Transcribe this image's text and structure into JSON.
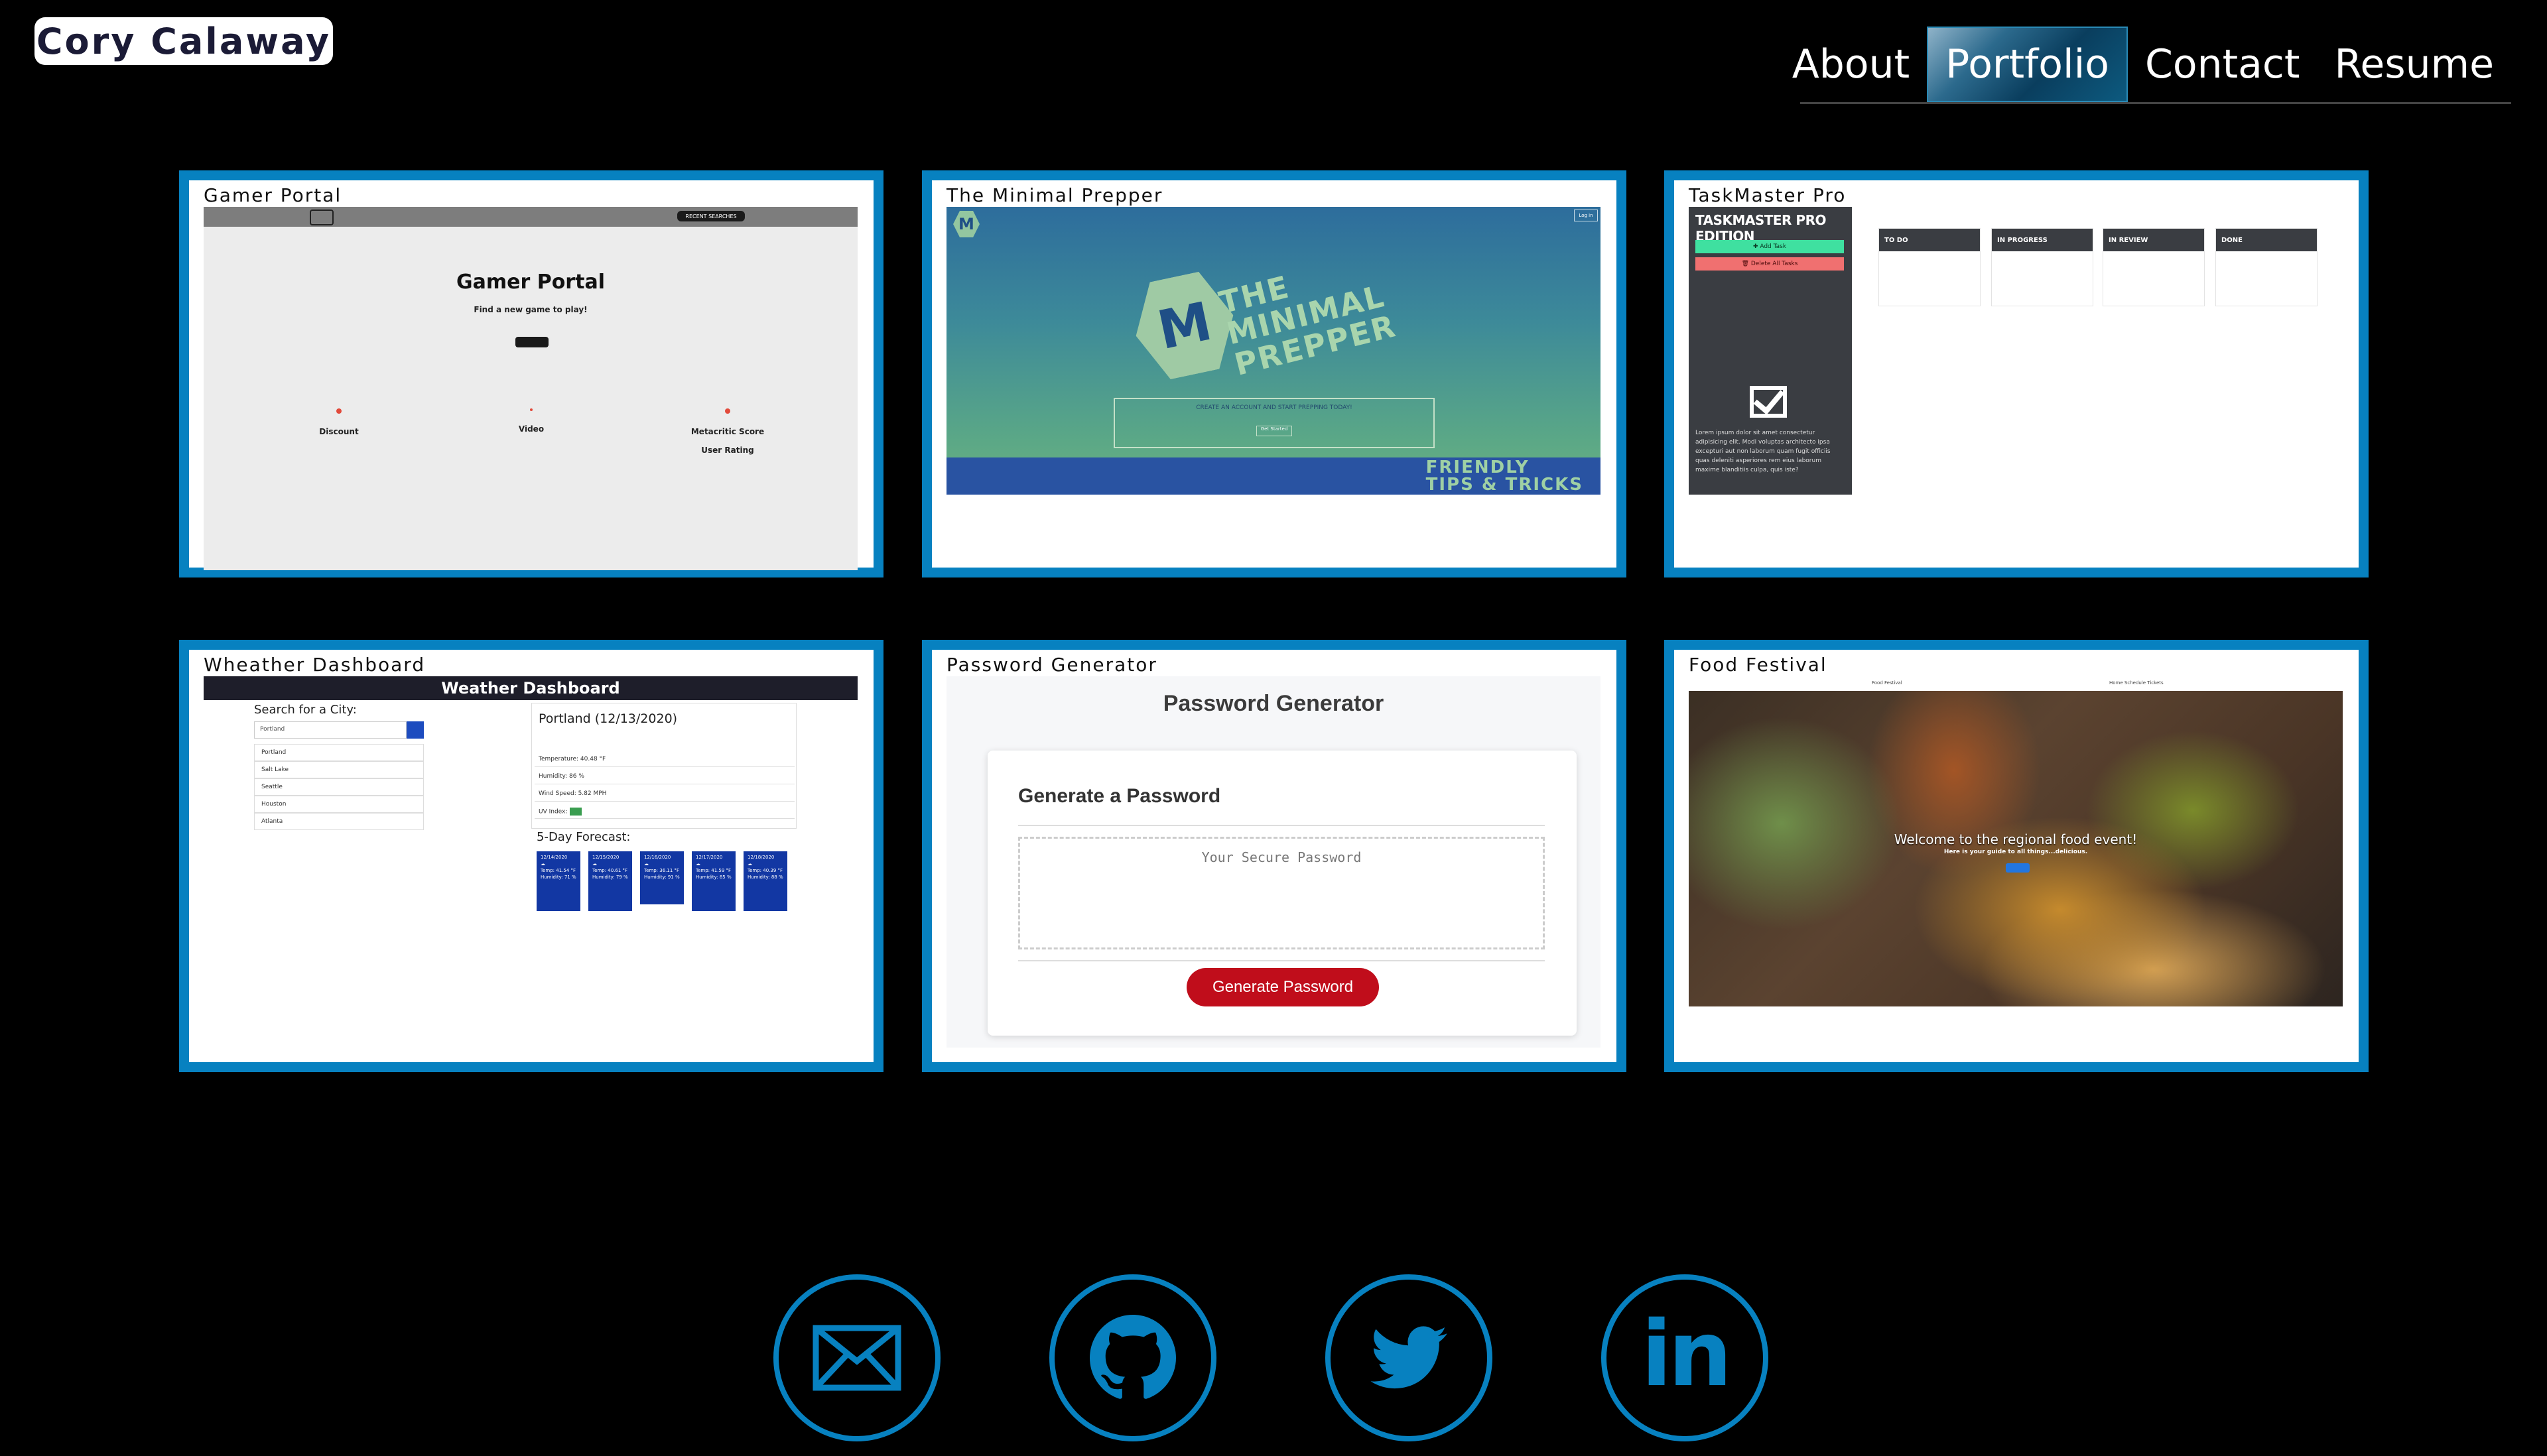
{
  "header": {
    "brand": "Cory Calaway",
    "nav": [
      "About",
      "Portfolio",
      "Contact",
      "Resume"
    ],
    "active_nav": "Portfolio"
  },
  "colors": {
    "accent": "#0781c0",
    "background": "#000000",
    "nav_active": "#0a3e5e"
  },
  "projects": [
    {
      "title": "Gamer Portal",
      "screenshot": {
        "badge": "RECENT SEARCHES",
        "heading": "Gamer Portal",
        "subtitle": "Find a new game to play!",
        "features": [
          "Discount",
          "Video",
          "Metacritic Score",
          "User Rating"
        ]
      }
    },
    {
      "title": "The Minimal Prepper",
      "screenshot": {
        "logo": "M",
        "login": "Log in",
        "name_lines": [
          "THE",
          "MINIMAL",
          "PREPPER"
        ],
        "box_text": "CREATE AN ACCOUNT AND START PREPPING TODAY!",
        "box_button": "Get Started",
        "tips_lines": [
          "FRIENDLY",
          "TIPS & TRICKS"
        ]
      }
    },
    {
      "title": "TaskMaster Pro",
      "screenshot": {
        "sidebar_title": "TASKMASTER PRO EDITION",
        "add_label": "✚ Add Task",
        "delete_label": "🗑 Delete All Tasks",
        "lorem": "Lorem ipsum dolor sit amet consectetur adipisicing elit. Modi voluptas architecto ipsa excepturi aut non laborum quam fugit officiis quas deleniti asperiores rem eius laborum maxime blanditiis culpa, quis iste?",
        "columns": [
          "TO DO",
          "IN PROGRESS",
          "IN REVIEW",
          "DONE"
        ]
      }
    },
    {
      "title": "Wheather Dashboard",
      "screenshot": {
        "header": "Weather Dashboard",
        "search_label": "Search for a City:",
        "search_value": "Portland",
        "cities": [
          "Portland",
          "Salt Lake",
          "Seattle",
          "Houston",
          "Atlanta"
        ],
        "city_title": "Portland (12/13/2020)",
        "stats": [
          "Temperature: 40.48 °F",
          "Humidity: 86 %",
          "Wind Speed: 5.82 MPH",
          "UV Index:"
        ],
        "forecast_title": "5-Day Forecast:",
        "forecast": [
          {
            "date": "12/14/2020",
            "temp": "Temp: 41.54 °F",
            "humidity": "Humidity: 71 %"
          },
          {
            "date": "12/15/2020",
            "temp": "Temp: 40.61 °F",
            "humidity": "Humidity: 79 %"
          },
          {
            "date": "12/16/2020",
            "temp": "Temp: 36.11 °F",
            "humidity": "Humidity: 91 %"
          },
          {
            "date": "12/17/2020",
            "temp": "Temp: 41.59 °F",
            "humidity": "Humidity: 85 %"
          },
          {
            "date": "12/18/2020",
            "temp": "Temp: 40.39 °F",
            "humidity": "Humidity: 88 %"
          }
        ]
      }
    },
    {
      "title": "Password Generator",
      "screenshot": {
        "heading": "Password Generator",
        "card_heading": "Generate a Password",
        "placeholder": "Your Secure Password",
        "button": "Generate Password"
      }
    },
    {
      "title": "Food Festival",
      "screenshot": {
        "nav_title": "Food Festival",
        "nav_links": "Home   Schedule   Tickets",
        "welcome": "Welcome to the regional food event!",
        "sub": "Here is your guide to all things...delicious."
      }
    }
  ],
  "social": [
    {
      "name": "email",
      "icon": "envelope-icon"
    },
    {
      "name": "github",
      "icon": "github-icon"
    },
    {
      "name": "twitter",
      "icon": "twitter-icon"
    },
    {
      "name": "linkedin",
      "icon": "linkedin-icon",
      "glyph": "in"
    }
  ]
}
